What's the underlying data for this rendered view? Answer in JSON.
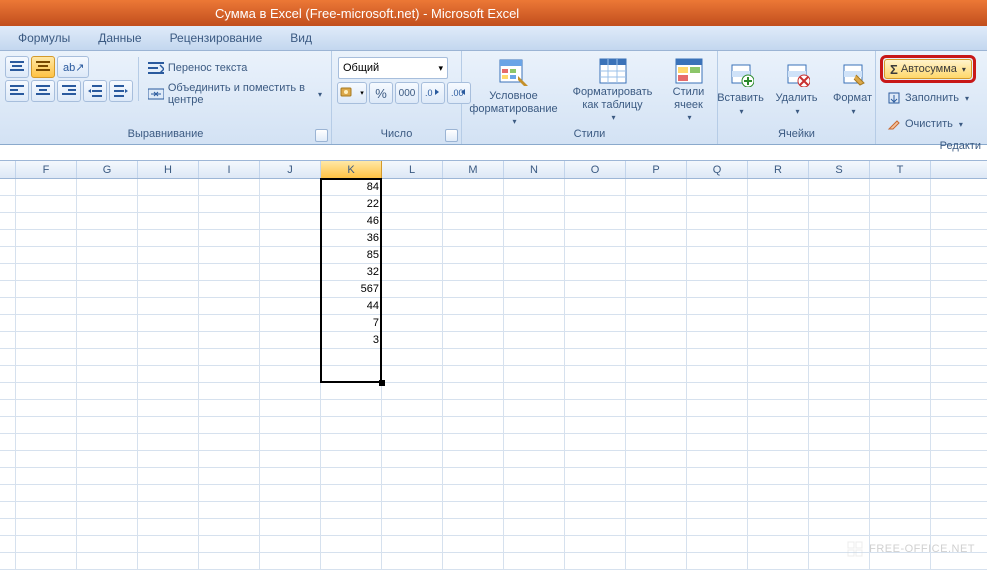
{
  "title": "Сумма в Excel (Free-microsoft.net) - Microsoft Excel",
  "tabs": [
    "Формулы",
    "Данные",
    "Рецензирование",
    "Вид"
  ],
  "ribbon": {
    "align": {
      "label": "Выравнивание",
      "wrap": "Перенос текста",
      "merge": "Объединить и поместить в центре"
    },
    "number": {
      "label": "Число",
      "format": "Общий",
      "percent": "%",
      "thousands": "000"
    },
    "styles": {
      "label": "Стили",
      "cond": "Условное форматирование",
      "table": "Форматировать как таблицу",
      "cell": "Стили ячеек"
    },
    "cells": {
      "label": "Ячейки",
      "insert": "Вставить",
      "delete": "Удалить",
      "format": "Формат"
    },
    "edit": {
      "label": "Редакти",
      "autosum": "Автосумма",
      "fill": "Заполнить",
      "clear": "Очистить"
    }
  },
  "columns": [
    "F",
    "G",
    "H",
    "I",
    "J",
    "K",
    "L",
    "M",
    "N",
    "O",
    "P",
    "Q",
    "R",
    "S",
    "T"
  ],
  "selected_col": "K",
  "k_values": [
    84,
    22,
    46,
    36,
    85,
    32,
    567,
    44,
    7,
    3
  ],
  "watermark": "FREE-OFFICE.NET"
}
